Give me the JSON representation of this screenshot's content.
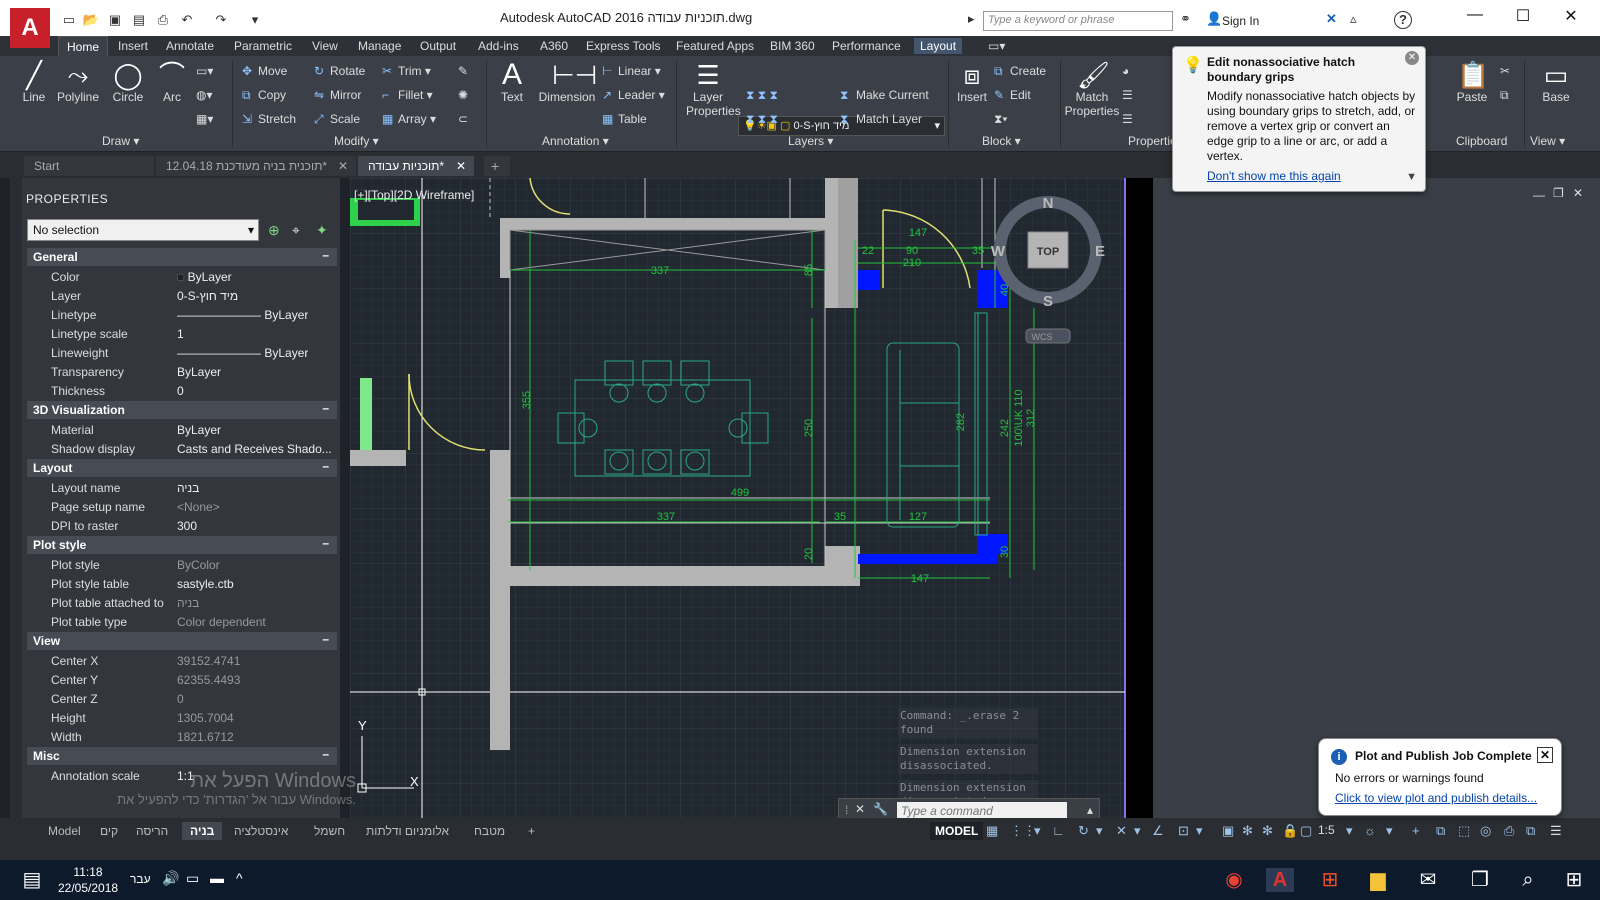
{
  "titlebar": {
    "title": "Autodesk AutoCAD 2016    תוכניות עבודה.dwg",
    "app_letter": "A",
    "search_placeholder": "Type a keyword or phrase",
    "signin": "Sign In",
    "help": "?"
  },
  "ribbon_tabs": [
    "Home",
    "Insert",
    "Annotate",
    "Parametric",
    "View",
    "Manage",
    "Output",
    "Add-ins",
    "A360",
    "Express Tools",
    "Featured Apps",
    "BIM 360",
    "Performance",
    "Layout"
  ],
  "ribbon": {
    "draw": {
      "label": "Draw ▾",
      "line": "Line",
      "polyline": "Polyline",
      "circle": "Circle",
      "arc": "Arc"
    },
    "modify": {
      "label": "Modify ▾",
      "move": "Move",
      "rotate": "Rotate",
      "trim": "Trim ▾",
      "copy": "Copy",
      "mirror": "Mirror",
      "fillet": "Fillet ▾",
      "stretch": "Stretch",
      "scale": "Scale",
      "array": "Array ▾"
    },
    "annotation": {
      "label": "Annotation ▾",
      "text": "Text",
      "dimension": "Dimension",
      "linear": "Linear ▾",
      "leader": "Leader ▾",
      "table": "Table"
    },
    "layers": {
      "label": "Layers ▾",
      "layer_properties": "Layer Properties",
      "layer_combo": "0-S-מיד חוץ",
      "make_current": "Make Current",
      "match_layer": "Match Layer"
    },
    "block": {
      "label": "Block ▾",
      "insert": "Insert",
      "create": "Create",
      "edit": "Edit"
    },
    "properties": {
      "label": "Properties ▾",
      "match": "Match Properties"
    },
    "clipboard": {
      "label": "Clipboard",
      "paste": "Paste"
    },
    "view": {
      "label": "View ▾",
      "base": "Base"
    }
  },
  "doc_tabs": [
    "Start",
    "12.04.18 תוכנית בניה מעודכנת*",
    "תוכניות עבודה*"
  ],
  "properties_panel": {
    "title": "PROPERTIES",
    "selection": "No selection",
    "sections": [
      {
        "name": "General",
        "rows": [
          [
            "Color",
            "ByLayer"
          ],
          [
            "Layer",
            "0-S-מיד חוץ"
          ],
          [
            "Linetype",
            "ByLayer"
          ],
          [
            "Linetype scale",
            "1"
          ],
          [
            "Lineweight",
            "ByLayer"
          ],
          [
            "Transparency",
            "ByLayer"
          ],
          [
            "Thickness",
            "0"
          ]
        ]
      },
      {
        "name": "3D Visualization",
        "rows": [
          [
            "Material",
            "ByLayer"
          ],
          [
            "Shadow display",
            "Casts and Receives Shado..."
          ]
        ]
      },
      {
        "name": "Layout",
        "rows": [
          [
            "Layout name",
            "בניה"
          ],
          [
            "Page setup name",
            "<None>"
          ],
          [
            "DPI to raster",
            "300"
          ]
        ]
      },
      {
        "name": "Plot style",
        "rows": [
          [
            "Plot style",
            "ByColor"
          ],
          [
            "Plot style table",
            "sastyle.ctb"
          ],
          [
            "Plot table attached to",
            "בניה"
          ],
          [
            "Plot table type",
            "Color dependent"
          ]
        ]
      },
      {
        "name": "View",
        "rows": [
          [
            "Center X",
            "39152.4741"
          ],
          [
            "Center Y",
            "62355.4493"
          ],
          [
            "Center Z",
            "0"
          ],
          [
            "Height",
            "1305.7004"
          ],
          [
            "Width",
            "1821.6712"
          ]
        ]
      },
      {
        "name": "Misc",
        "rows": [
          [
            "Annotation scale",
            "1:1"
          ]
        ]
      }
    ]
  },
  "viewport_label": "[+][Top][2D Wireframe]",
  "viewcube": {
    "n": "N",
    "s": "S",
    "e": "E",
    "w": "W",
    "top": "TOP",
    "wcs": "WCS"
  },
  "dimensions": [
    "337",
    "85",
    "22",
    "90",
    "210",
    "35",
    "147",
    "40",
    "355",
    "250",
    "282",
    "242",
    "100\\UK 110",
    "312",
    "499",
    "337",
    "35",
    "127",
    "20",
    "30",
    "147"
  ],
  "command": {
    "history": [
      "Command: _.erase 2 found",
      "Dimension extension disassociated.",
      "Dimension extension disassociated."
    ],
    "placeholder": "Type a command"
  },
  "layout_tabs": [
    "Model",
    "קים",
    "הריסה",
    "בניה",
    "אינסטלציה",
    "חשמל",
    "אלומניום ודלתות",
    "מטבח",
    "+"
  ],
  "active_layout": "בניה",
  "status": {
    "model": "MODEL",
    "scale": "1:5"
  },
  "tooltip": {
    "title": "Edit nonassociative hatch boundary grips",
    "body": "Modify nonassociative hatch objects by using boundary grips to stretch, add, or remove a vertex grip or convert an edge grip to a line or arc, or add a vertex.",
    "link": "Don't show me this again"
  },
  "notification": {
    "title": "Plot and Publish Job Complete",
    "body": "No errors or warnings found",
    "link": "Click to view plot and publish details..."
  },
  "watermark": {
    "line1": "הפעל את Windows",
    "line2": "עבור אל 'הגדרות' כדי להפעיל את Windows."
  },
  "taskbar": {
    "time": "11:18",
    "date": "22/05/2018",
    "lang": "עבר"
  },
  "colors": {
    "accent": "#c8202a",
    "dim_green": "#22c33a",
    "wall_gray": "#b4b4b4",
    "hatch_blue": "#0016ff",
    "door_yellow": "#e0e070",
    "furniture": "#2aa888"
  }
}
